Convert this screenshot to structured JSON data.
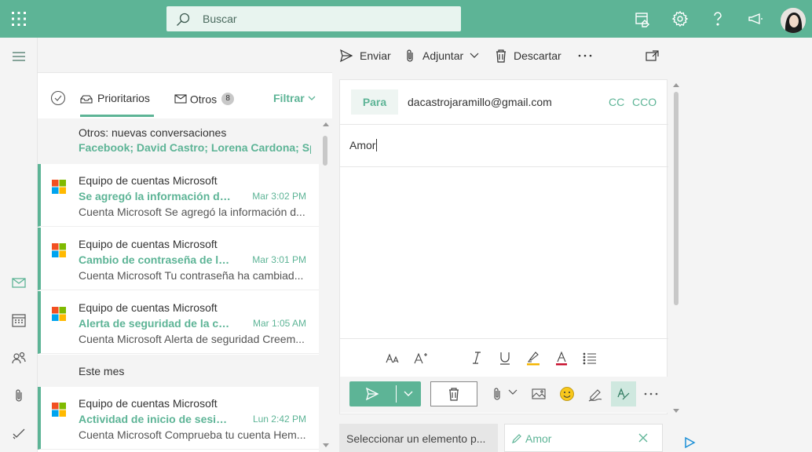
{
  "header": {
    "search_placeholder": "Buscar",
    "accent": "#5db496"
  },
  "toolbar": {
    "send_label": "Enviar",
    "attach_label": "Adjuntar",
    "discard_label": "Descartar"
  },
  "list": {
    "tabs": [
      {
        "label": "Prioritarios",
        "active": true
      },
      {
        "label": "Otros",
        "badge": "8"
      }
    ],
    "filter_label": "Filtrar",
    "others_group": {
      "title": "Otros: nuevas conversaciones",
      "senders": "Facebook; David Castro; Lorena Cardona; Sp..."
    },
    "month_label": "Este mes",
    "messages": [
      {
        "from": "Equipo de cuentas Microsoft",
        "subject": "Se agregó la información de...",
        "time": "Mar 3:02 PM",
        "preview": "Cuenta Microsoft Se agregó la información d..."
      },
      {
        "from": "Equipo de cuentas Microsoft",
        "subject": "Cambio de contraseña de la ...",
        "time": "Mar 3:01 PM",
        "preview": "Cuenta Microsoft Tu contraseña ha cambiad..."
      },
      {
        "from": "Equipo de cuentas Microsoft",
        "subject": "Alerta de seguridad de la cu...",
        "time": "Mar 1:05 AM",
        "preview": "Cuenta Microsoft Alerta de seguridad Creem..."
      },
      {
        "from": "Equipo de cuentas Microsoft",
        "subject": "Actividad de inicio de sesión...",
        "time": "Lun 2:42 PM",
        "preview": "Cuenta Microsoft Comprueba tu cuenta Hem..."
      }
    ]
  },
  "compose": {
    "to_label": "Para",
    "to_value": "dacastrojaramillo@gmail.com",
    "cc_label": "CC",
    "bcc_label": "CCO",
    "subject_value": "Amor"
  },
  "bottom": {
    "select_item": "Seleccionar un elemento p...",
    "draft_tab": "Amor"
  }
}
